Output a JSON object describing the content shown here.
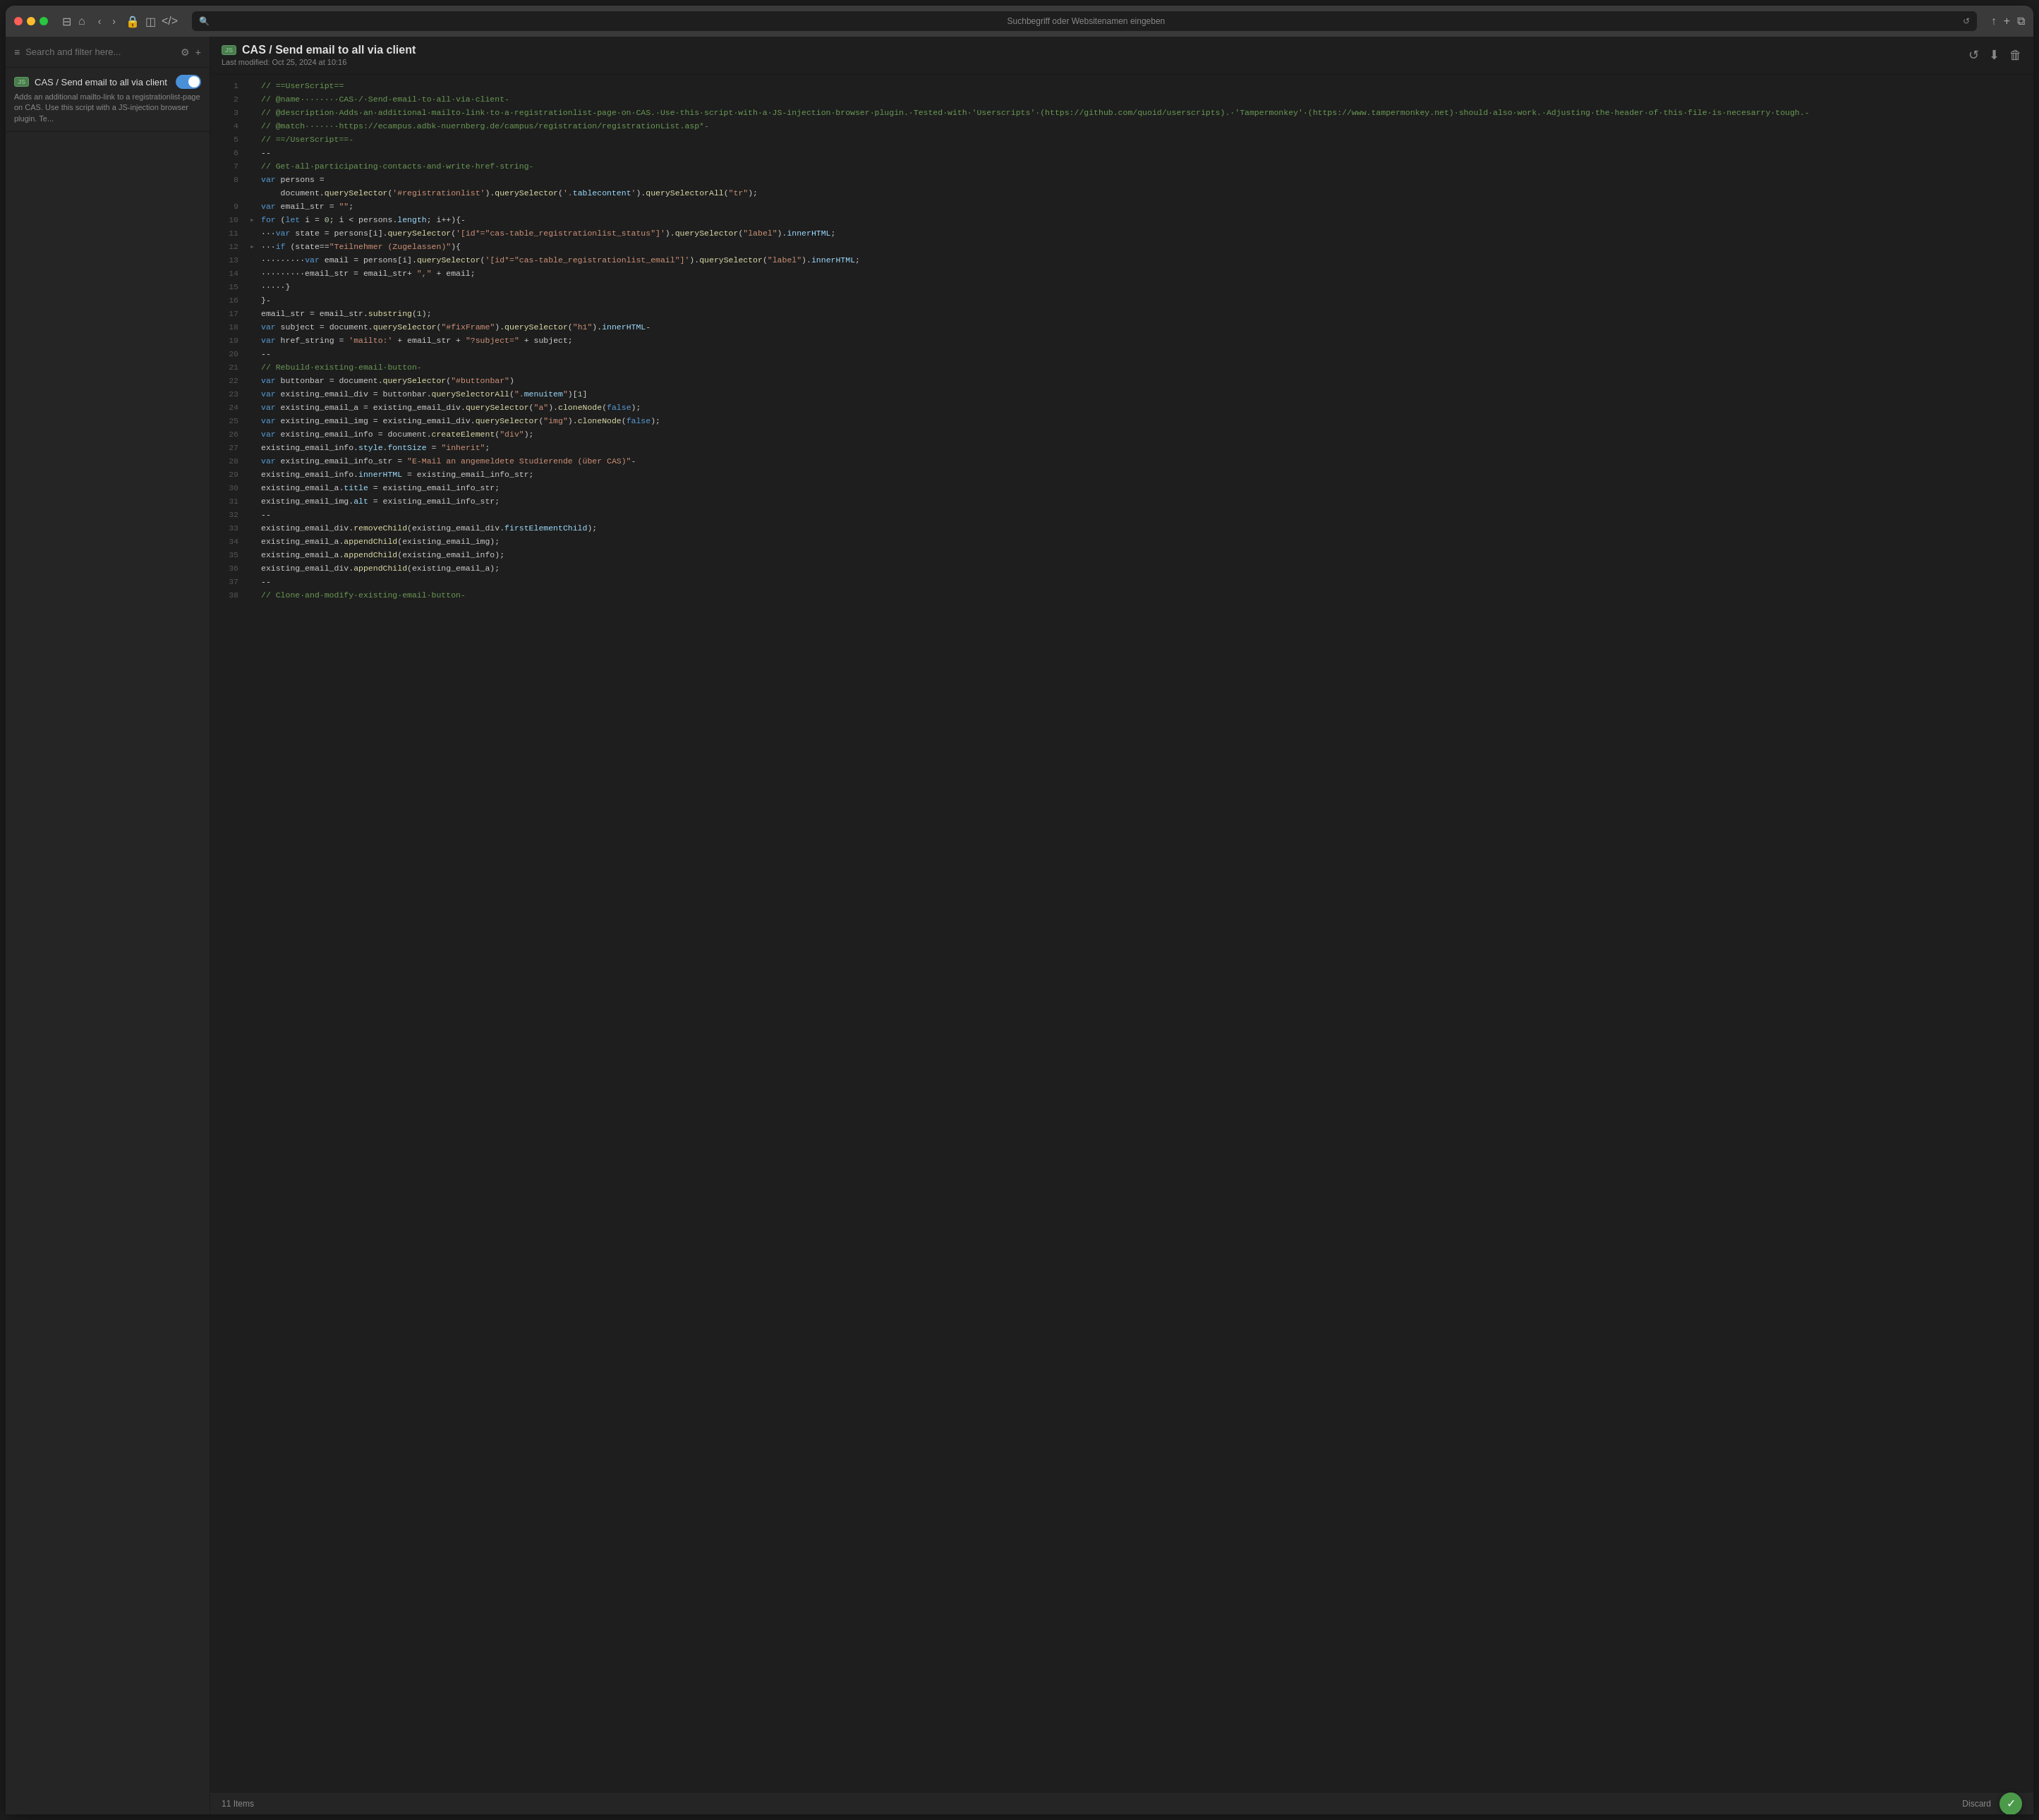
{
  "window": {
    "address_bar_placeholder": "Suchbegriff oder Websitenamen eingeben"
  },
  "sidebar": {
    "search_placeholder": "Search and filter here...",
    "items_count": "11 Items",
    "scripts": [
      {
        "id": "cas-send-email",
        "badge": "JS",
        "name": "CAS / Send email to all via client",
        "description": "Adds an additional mailto-link to a registrationlist-page on CAS. Use this script with a JS-injection browser plugin. Te...",
        "enabled": true
      }
    ]
  },
  "editor": {
    "badge": "JS",
    "title": "CAS / Send email to all via client",
    "subtitle": "Last modified: Oct 25, 2024 at 10:16",
    "lines": [
      {
        "num": 1,
        "arrow": "",
        "content": "// ==UserScript=="
      },
      {
        "num": 2,
        "arrow": "",
        "content": "// @name········CAS·/·Send·email·to·all·via·client-"
      },
      {
        "num": 3,
        "arrow": "",
        "content": "// @description·Adds·an·additional·mailto-link·to·a·registrationlist-page·on·CAS.·Use·this·script·with·a·JS-injection·browser·plugin.·Tested·with·'Userscripts'·(https://github.com/quoid/userscripts).·'Tampermonkey'·(https://www.tampermonkey.net)·should·also·work.·Adjusting·the·header·of·this·file·is·necesarry·tough.-"
      },
      {
        "num": 4,
        "arrow": "",
        "content": "// @match·······https://ecampus.adbk-nuernberg.de/campus/registration/registrationList.asp*-"
      },
      {
        "num": 5,
        "arrow": "",
        "content": "// ==/UserScript==-"
      },
      {
        "num": 6,
        "arrow": "",
        "content": "--"
      },
      {
        "num": 7,
        "arrow": "",
        "content": "// Get·all·participating·contacts·and·write·href·string-"
      },
      {
        "num": 8,
        "arrow": "",
        "content": "var persons ="
      },
      {
        "num": "",
        "arrow": "",
        "content": "    document.querySelector('#registrationlist').querySelector('.tablecontent').querySelectorAll(\"tr\");"
      },
      {
        "num": 9,
        "arrow": "",
        "content": "var email_str = \"\";"
      },
      {
        "num": 10,
        "arrow": "▸",
        "content": "for (let i = 0; i < persons.length; i++){-"
      },
      {
        "num": 11,
        "arrow": "",
        "content": "···var state = persons[i].querySelector('[id*=\"cas-table_registrationlist_status\"]').querySelector(\"label\").innerHTML;"
      },
      {
        "num": 12,
        "arrow": "▸",
        "content": "···if (state==\"Teilnehmer (Zugelassen)\"){"
      },
      {
        "num": 13,
        "arrow": "",
        "content": "·········var email = persons[i].querySelector('[id*=\"cas-table_registrationlist_email\"]').querySelector(\"label\").innerHTML;"
      },
      {
        "num": 14,
        "arrow": "",
        "content": "·········email_str = email_str+ \",\" + email;"
      },
      {
        "num": 15,
        "arrow": "",
        "content": "·····}"
      },
      {
        "num": 16,
        "arrow": "",
        "content": "}-"
      },
      {
        "num": 17,
        "arrow": "",
        "content": "email_str = email_str.substring(1);"
      },
      {
        "num": 18,
        "arrow": "",
        "content": "var subject = document.querySelector(\"#fixFrame\").querySelector(\"h1\").innerHTML-"
      },
      {
        "num": 19,
        "arrow": "",
        "content": "var href_string = 'mailto:' + email_str + \"?subject=\" + subject;"
      },
      {
        "num": 20,
        "arrow": "",
        "content": "--"
      },
      {
        "num": 21,
        "arrow": "",
        "content": "// Rebuild·existing·email·button-"
      },
      {
        "num": 22,
        "arrow": "",
        "content": "var buttonbar = document.querySelector(\"#buttonbar\")"
      },
      {
        "num": 23,
        "arrow": "",
        "content": "var existing_email_div = buttonbar.querySelectorAll(\".menuitem\")[1]"
      },
      {
        "num": 24,
        "arrow": "",
        "content": "var existing_email_a = existing_email_div.querySelector(\"a\").cloneNode(false);"
      },
      {
        "num": 25,
        "arrow": "",
        "content": "var existing_email_img = existing_email_div.querySelector(\"img\").cloneNode(false);"
      },
      {
        "num": 26,
        "arrow": "",
        "content": "var existing_email_info = document.createElement(\"div\");"
      },
      {
        "num": 27,
        "arrow": "",
        "content": "existing_email_info.style.fontSize = \"inherit\";"
      },
      {
        "num": 28,
        "arrow": "",
        "content": "var existing_email_info_str = \"E-Mail an angemeldete Studierende (über CAS)\"-"
      },
      {
        "num": 29,
        "arrow": "",
        "content": "existing_email_info.innerHTML = existing_email_info_str;"
      },
      {
        "num": 30,
        "arrow": "",
        "content": "existing_email_a.title = existing_email_info_str;"
      },
      {
        "num": 31,
        "arrow": "",
        "content": "existing_email_img.alt = existing_email_info_str;"
      },
      {
        "num": 32,
        "arrow": "",
        "content": "--"
      },
      {
        "num": 33,
        "arrow": "",
        "content": "existing_email_div.removeChild(existing_email_div.firstElementChild);"
      },
      {
        "num": 34,
        "arrow": "",
        "content": "existing_email_a.appendChild(existing_email_img);"
      },
      {
        "num": 35,
        "arrow": "",
        "content": "existing_email_a.appendChild(existing_email_info);"
      },
      {
        "num": 36,
        "arrow": "",
        "content": "existing_email_div.appendChild(existing_email_a);"
      },
      {
        "num": 37,
        "arrow": "",
        "content": "--"
      },
      {
        "num": 38,
        "arrow": "",
        "content": "// Clone·and·modify·existing·email·button-"
      }
    ]
  },
  "status_bar": {
    "items_label": "11 Items",
    "discard_label": "Discard"
  },
  "icons": {
    "hamburger": "≡",
    "settings": "⚙",
    "plus": "+",
    "back": "‹",
    "forward": "›",
    "lock": "🔒",
    "extensions": "◫",
    "code": "</>",
    "share": "↑",
    "new_tab": "+",
    "tabs": "⧉",
    "refresh": "↺",
    "reload_editor": "↺",
    "download": "↓",
    "trash": "🗑",
    "cursor": "⊕"
  }
}
